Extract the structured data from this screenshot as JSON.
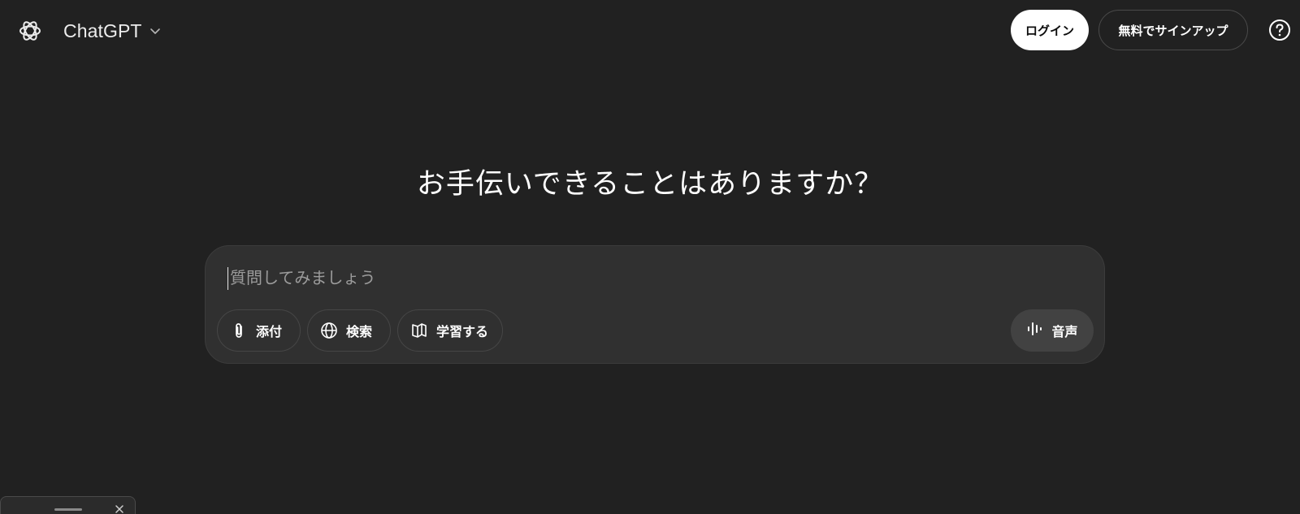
{
  "header": {
    "logo_icon": "openai-logo-icon",
    "model_name": "ChatGPT",
    "model_chevron_icon": "chevron-down-icon",
    "login_label": "ログイン",
    "signup_label": "無料でサインアップ",
    "help_icon": "question-circle-icon"
  },
  "main": {
    "headline": "お手伝いできることはありますか？"
  },
  "composer": {
    "placeholder": "質問してみましょう",
    "value": "",
    "tools": [
      {
        "label": "添付",
        "icon": "paperclip-icon"
      },
      {
        "label": "検索",
        "icon": "globe-icon"
      },
      {
        "label": "学習する",
        "icon": "book-icon"
      }
    ],
    "voice": {
      "label": "音声",
      "icon": "voice-waveform-icon"
    }
  },
  "mini_panel": {
    "handle_icon": "drag-handle-icon",
    "close_icon": "close-icon"
  },
  "colors": {
    "background": "#212121",
    "composer_bg": "#303030",
    "login_bg": "#ffffff",
    "voice_bg": "#424242",
    "text": "#ececec"
  }
}
